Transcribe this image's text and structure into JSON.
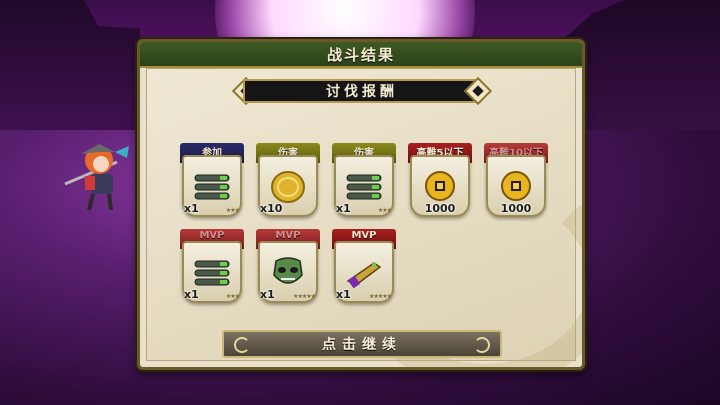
{
  "panel": {
    "title": "战斗结果"
  },
  "ribbon": {
    "label": "讨伐报酬"
  },
  "rewards": [
    {
      "tag": "参加",
      "tag_color": "blue",
      "item": "bullet-clip",
      "qty": "x1",
      "stars": "★★★"
    },
    {
      "tag": "伤害",
      "tag_color": "olive",
      "item": "gold-medal",
      "qty": "x10",
      "stars": ""
    },
    {
      "tag": "伤害",
      "tag_color": "olive",
      "item": "bullet-clip",
      "qty": "x1",
      "stars": "★★★"
    },
    {
      "tag": "高難5以下",
      "tag_color": "red",
      "item": "gold-coin",
      "qty": "1000",
      "stars": ""
    },
    {
      "tag": "高難10以下",
      "tag_color": "red",
      "item": "gold-coin",
      "qty": "1000",
      "stars": ""
    },
    {
      "tag": "MVP",
      "tag_color": "red",
      "item": "bullet-clip",
      "qty": "x1",
      "stars": "★★★"
    },
    {
      "tag": "MVP",
      "tag_color": "red",
      "item": "green-mask",
      "qty": "x1",
      "stars": "★★★★★"
    },
    {
      "tag": "MVP",
      "tag_color": "red",
      "item": "gun",
      "qty": "x1",
      "stars": "★★★★★"
    }
  ],
  "continue_button": {
    "label": "点击继续"
  },
  "colors": {
    "header_green": "#3f5a24",
    "frame_gold": "#b59a4c",
    "panel_bg": "#e9e1cc",
    "background_purple": "#6a1a7a"
  }
}
